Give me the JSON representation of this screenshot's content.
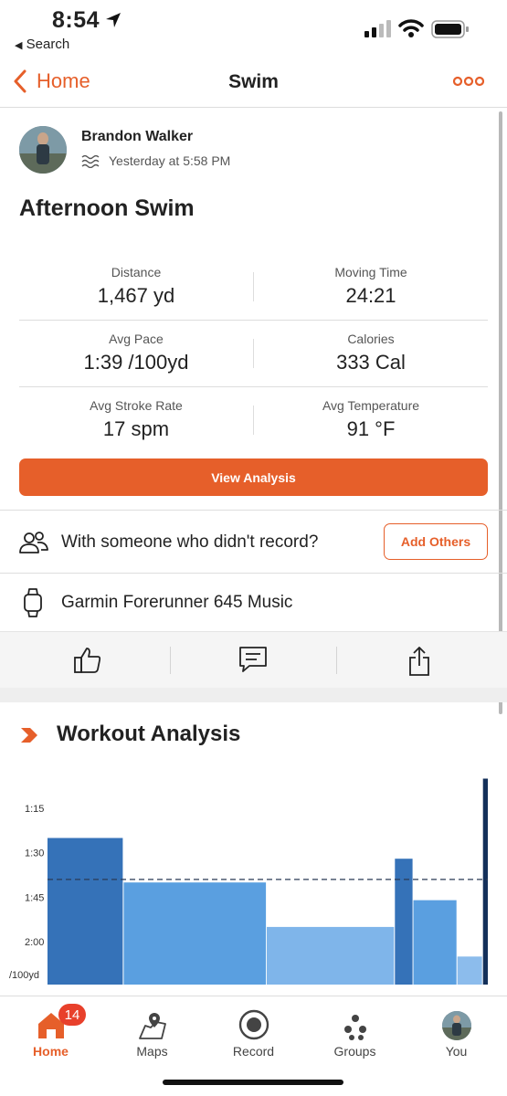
{
  "status_bar": {
    "time": "8:54",
    "back_app": "Search"
  },
  "nav": {
    "back_label": "Home",
    "title": "Swim"
  },
  "activity": {
    "athlete": "Brandon Walker",
    "when": "Yesterday at 5:58 PM",
    "title": "Afternoon Swim",
    "stats": [
      {
        "label": "Distance",
        "value": "1,467 yd"
      },
      {
        "label": "Moving Time",
        "value": "24:21"
      },
      {
        "label": "Avg Pace",
        "value": "1:39 /100yd"
      },
      {
        "label": "Calories",
        "value": "333 Cal"
      },
      {
        "label": "Avg Stroke Rate",
        "value": "17 spm"
      },
      {
        "label": "Avg Temperature",
        "value": "91 °F"
      }
    ],
    "view_analysis_label": "View Analysis",
    "with_others_text": "With someone who didn't record?",
    "add_others_label": "Add Others",
    "device": "Garmin Forerunner 645 Music"
  },
  "analysis": {
    "title": "Workout Analysis"
  },
  "chart_data": {
    "type": "bar",
    "ytick_labels": [
      "1:15",
      "1:30",
      "1:45",
      "2:00",
      "/100yd"
    ],
    "ytick_seconds": [
      75,
      90,
      105,
      120
    ],
    "y_reversed": true,
    "average_line_seconds": 99,
    "segments": [
      {
        "start": 0.0,
        "end": 0.171,
        "pace_seconds": 85,
        "color": "#3572b8"
      },
      {
        "start": 0.173,
        "end": 0.496,
        "pace_seconds": 100,
        "color": "#5a9fe0"
      },
      {
        "start": 0.498,
        "end": 0.787,
        "pace_seconds": 115,
        "color": "#7fb5ea"
      },
      {
        "start": 0.789,
        "end": 0.829,
        "pace_seconds": 92,
        "color": "#3572b8"
      },
      {
        "start": 0.831,
        "end": 0.929,
        "pace_seconds": 106,
        "color": "#5a9fe0"
      },
      {
        "start": 0.931,
        "end": 0.987,
        "pace_seconds": 125,
        "color": "#8cbcec"
      },
      {
        "start": 0.989,
        "end": 1.0,
        "pace_seconds": 65,
        "color": "#14305a"
      }
    ]
  },
  "tabbar": {
    "badge_count": "14",
    "tabs": [
      {
        "label": "Home"
      },
      {
        "label": "Maps"
      },
      {
        "label": "Record"
      },
      {
        "label": "Groups"
      },
      {
        "label": "You"
      }
    ]
  },
  "colors": {
    "accent": "#e65f2a"
  }
}
